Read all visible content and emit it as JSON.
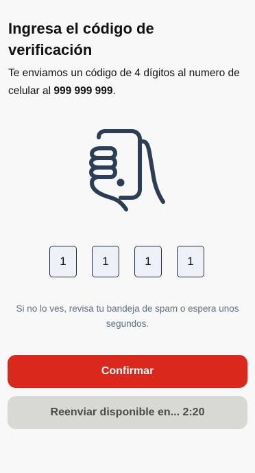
{
  "header": {
    "title": "Ingresa el código de verificación"
  },
  "message": {
    "prefix": "Te enviamos un código de 4 dígitos al numero de celular al ",
    "phone": "999 999 999",
    "suffix": "."
  },
  "illustration": {
    "icon": "hand-holding-phone-icon",
    "stroke_color": "#2c3e55"
  },
  "code": {
    "digits": [
      "1",
      "1",
      "1",
      "1"
    ]
  },
  "hint": "Si no lo ves, revisa tu bandeja de spam o espera unos segundos.",
  "actions": {
    "confirm_label": "Confirmar",
    "resend_label": "Reenviar disponible en... 2:20"
  },
  "colors": {
    "primary": "#da291c",
    "disabled": "#d9d9d4",
    "hint_text": "#5b6f86"
  }
}
